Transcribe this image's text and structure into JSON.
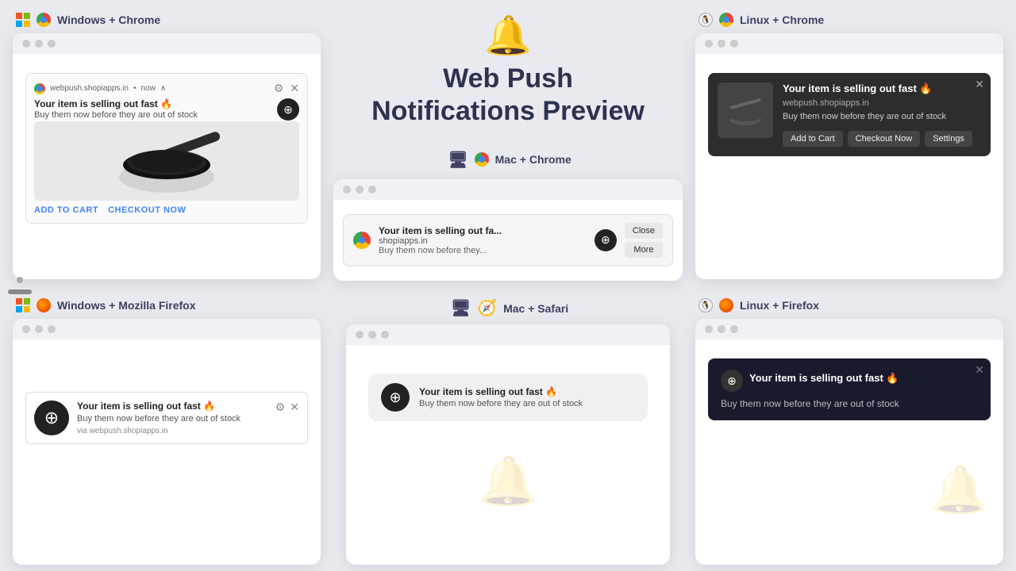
{
  "hero": {
    "title_line1": "Web Push",
    "title_line2": "Notifications Preview",
    "bell_emoji": "🔔"
  },
  "notification": {
    "title": "Your item is selling out fast 🔥",
    "title_short": "Your item is selling out fa...",
    "body": "Buy them now before they are out of stock",
    "body_short": "Buy them now before they...",
    "source": "webpush.shopiapps.in",
    "source_short": "shopiapps.in",
    "time": "now",
    "fire_emoji": "🔥"
  },
  "platforms": {
    "win_chrome": {
      "label": "Windows + Chrome"
    },
    "mac_chrome": {
      "label": "Mac + Chrome"
    },
    "linux_chrome": {
      "label": "Linux + Chrome"
    },
    "win_firefox": {
      "label": "Windows + Mozilla Firefox"
    },
    "mac_safari": {
      "label": "Mac + Safari"
    },
    "linux_firefox": {
      "label": "Linux + Firefox"
    }
  },
  "buttons": {
    "add_to_cart": "ADD TO CART",
    "checkout_now": "CHECKOUT NOW",
    "close": "Close",
    "more": "More",
    "add_to_cart_dark": "Add to Cart",
    "checkout_now_dark": "Checkout Now",
    "settings": "Settings"
  }
}
